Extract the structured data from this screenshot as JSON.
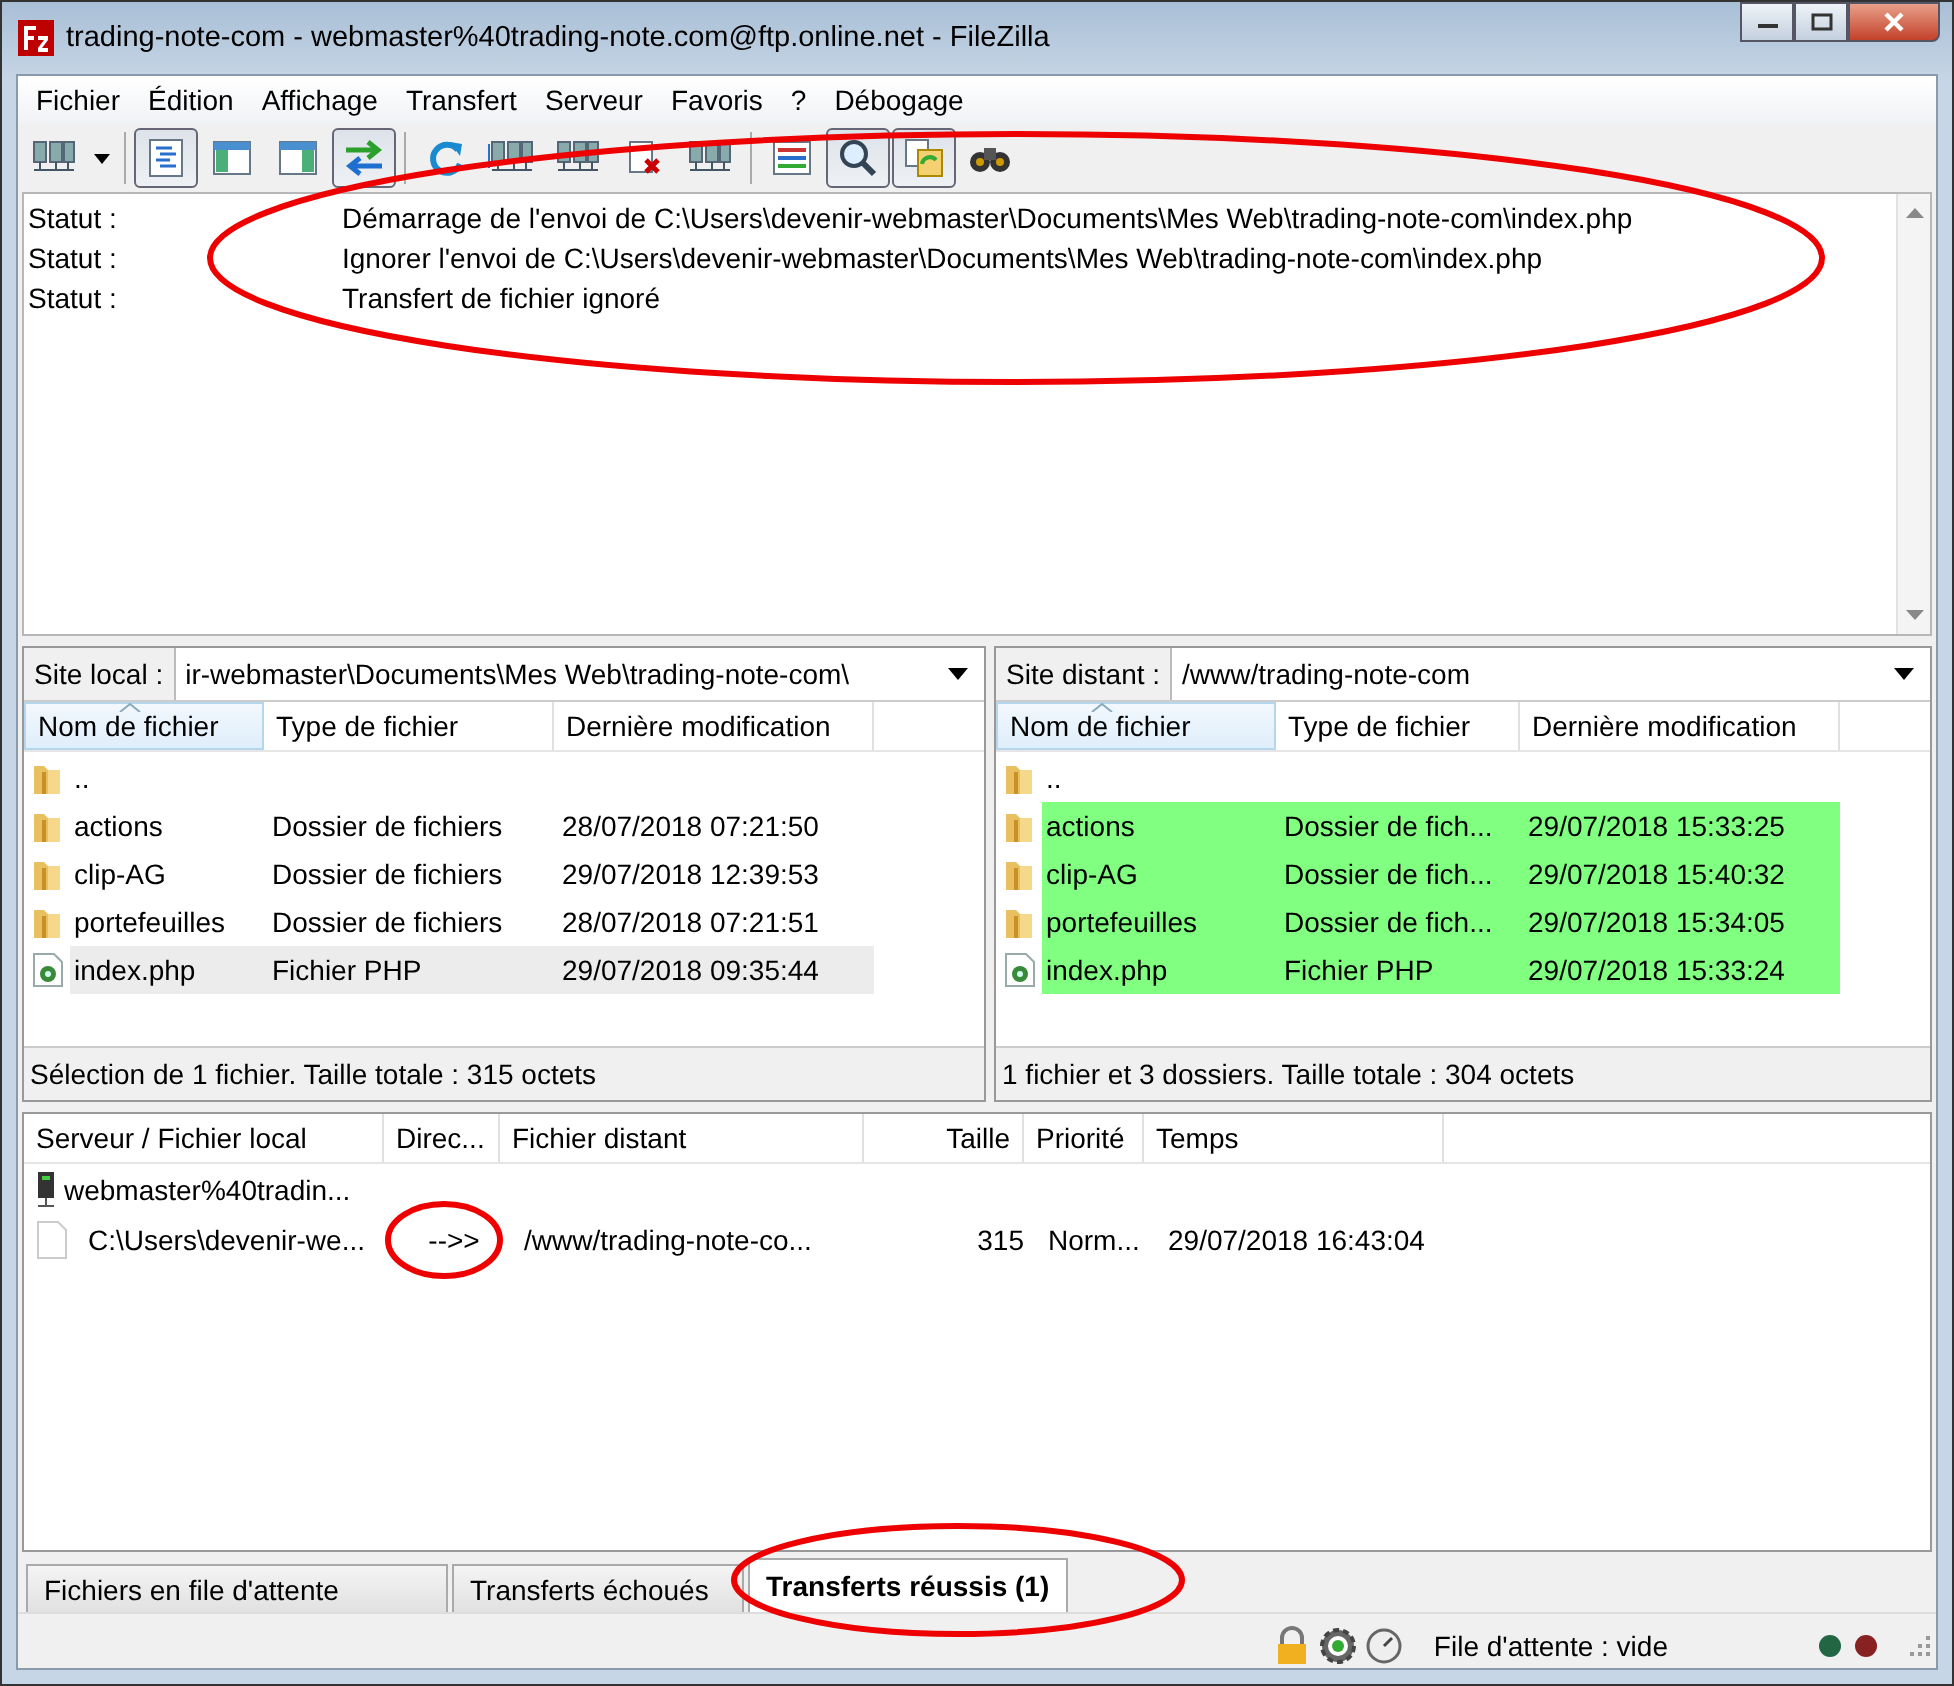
{
  "window": {
    "title": "trading-note-com - webmaster%40trading-note.com@ftp.online.net - FileZilla"
  },
  "menu": [
    "Fichier",
    "Édition",
    "Affichage",
    "Transfert",
    "Serveur",
    "Favoris",
    "?",
    "Débogage"
  ],
  "toolbar": [
    {
      "kind": "sitemanager",
      "pressed": false
    },
    {
      "kind": "dropdown",
      "pressed": false
    },
    {
      "kind": "log",
      "pressed": true
    },
    {
      "kind": "localtree",
      "pressed": false
    },
    {
      "kind": "remotetree",
      "pressed": false
    },
    {
      "kind": "sync",
      "pressed": true
    },
    {
      "kind": "refresh",
      "pressed": false
    },
    {
      "kind": "process",
      "pressed": false
    },
    {
      "kind": "server",
      "pressed": false
    },
    {
      "kind": "cancel",
      "pressed": false
    },
    {
      "kind": "server",
      "pressed": false
    },
    {
      "kind": "filter",
      "pressed": false
    },
    {
      "kind": "search",
      "pressed": true
    },
    {
      "kind": "compare",
      "pressed": true
    },
    {
      "kind": "find",
      "pressed": false
    }
  ],
  "log": [
    {
      "label": "Statut :",
      "message": "Démarrage de l'envoi de C:\\Users\\devenir-webmaster\\Documents\\Mes Web\\trading-note-com\\index.php"
    },
    {
      "label": "Statut :",
      "message": "Ignorer l'envoi de C:\\Users\\devenir-webmaster\\Documents\\Mes Web\\trading-note-com\\index.php"
    },
    {
      "label": "Statut :",
      "message": "Transfert de fichier ignoré"
    }
  ],
  "panes": [
    {
      "site_label": "Site local :",
      "path": "ir-webmaster\\Documents\\Mes Web\\trading-note-com\\",
      "columns": [
        {
          "label": "Nom de fichier",
          "sorted": true
        },
        {
          "label": "Type de fichier",
          "sorted": false
        },
        {
          "label": "Dernière modification",
          "sorted": false
        }
      ],
      "rows": [
        {
          "kind": "folder",
          "name": "..",
          "selected": false,
          "highlighted": false
        },
        {
          "kind": "folder",
          "name": "actions",
          "type": "Dossier de fichiers",
          "modified": "28/07/2018 07:21:50",
          "selected": false,
          "highlighted": false
        },
        {
          "kind": "folder",
          "name": "clip-AG",
          "type": "Dossier de fichiers",
          "modified": "29/07/2018 12:39:53",
          "selected": false,
          "highlighted": false
        },
        {
          "kind": "folder",
          "name": "portefeuilles",
          "type": "Dossier de fichiers",
          "modified": "28/07/2018 07:21:51",
          "selected": false,
          "highlighted": false
        },
        {
          "kind": "file",
          "name": "index.php",
          "type": "Fichier PHP",
          "modified": "29/07/2018 09:35:44",
          "selected": true,
          "highlighted": false
        }
      ],
      "status": "Sélection de 1 fichier. Taille totale : 315 octets"
    },
    {
      "site_label": "Site distant :",
      "path": "/www/trading-note-com",
      "columns": [
        {
          "label": "Nom de fichier",
          "sorted": true
        },
        {
          "label": "Type de fichier",
          "sorted": false
        },
        {
          "label": "Dernière modification",
          "sorted": false
        }
      ],
      "rows": [
        {
          "kind": "folder",
          "name": "..",
          "selected": false,
          "highlighted": false
        },
        {
          "kind": "folder",
          "name": "actions",
          "type": "Dossier de fich...",
          "modified": "29/07/2018 15:33:25",
          "selected": false,
          "highlighted": true
        },
        {
          "kind": "folder",
          "name": "clip-AG",
          "type": "Dossier de fich...",
          "modified": "29/07/2018 15:40:32",
          "selected": false,
          "highlighted": true
        },
        {
          "kind": "folder",
          "name": "portefeuilles",
          "type": "Dossier de fich...",
          "modified": "29/07/2018 15:34:05",
          "selected": false,
          "highlighted": true
        },
        {
          "kind": "file",
          "name": "index.php",
          "type": "Fichier PHP",
          "modified": "29/07/2018 15:33:24",
          "selected": false,
          "highlighted": true
        }
      ],
      "status": "1 fichier et 3 dossiers. Taille totale : 304 octets"
    }
  ],
  "queue": {
    "columns": [
      "Serveur / Fichier local",
      "Direc...",
      "Fichier distant",
      "Taille",
      "Priorité",
      "Temps"
    ],
    "rows": [
      {
        "kind": "server",
        "local": "webmaster%40tradin..."
      },
      {
        "kind": "file",
        "local": "C:\\Users\\devenir-we...",
        "direction": "-->>",
        "remote": "/www/trading-note-co...",
        "size": "315",
        "priority": "Norm...",
        "time": "29/07/2018 16:43:04"
      }
    ]
  },
  "tabs": [
    {
      "label": "Fichiers en file d'attente",
      "selected": false
    },
    {
      "label": "Transferts échoués",
      "selected": false
    },
    {
      "label": "Transferts réussis (1)",
      "selected": true
    }
  ],
  "status_bar": {
    "queue_text": "File d'attente : vide"
  },
  "highlight_circles": [
    {
      "kind": "ellipse"
    },
    {
      "kind": "ellipse"
    },
    {
      "kind": "ellipse"
    }
  ]
}
